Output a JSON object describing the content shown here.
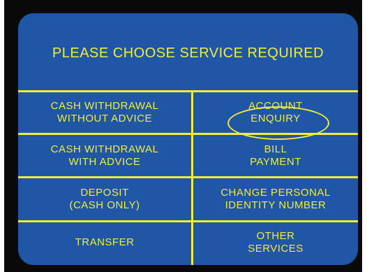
{
  "screen": {
    "title": "PLEASE CHOOSE SERVICE REQUIRED"
  },
  "options": [
    {
      "line1": "CASH WITHDRAWAL",
      "line2": "WITHOUT ADVICE"
    },
    {
      "line1": "ACCOUNT",
      "line2": "ENQUIRY",
      "highlighted": true
    },
    {
      "line1": "CASH WITHDRAWAL",
      "line2": "WITH ADVICE"
    },
    {
      "line1": "BILL",
      "line2": "PAYMENT"
    },
    {
      "line1": "DEPOSIT",
      "line2": "(CASH ONLY)"
    },
    {
      "line1": "CHANGE PERSONAL",
      "line2": "IDENTITY NUMBER"
    },
    {
      "line1": "TRANSFER",
      "line2": ""
    },
    {
      "line1": "OTHER",
      "line2": "SERVICES"
    }
  ],
  "colors": {
    "background": "#1f57a6",
    "text": "#f3ec3a",
    "bezel": "#0a0a0a"
  }
}
